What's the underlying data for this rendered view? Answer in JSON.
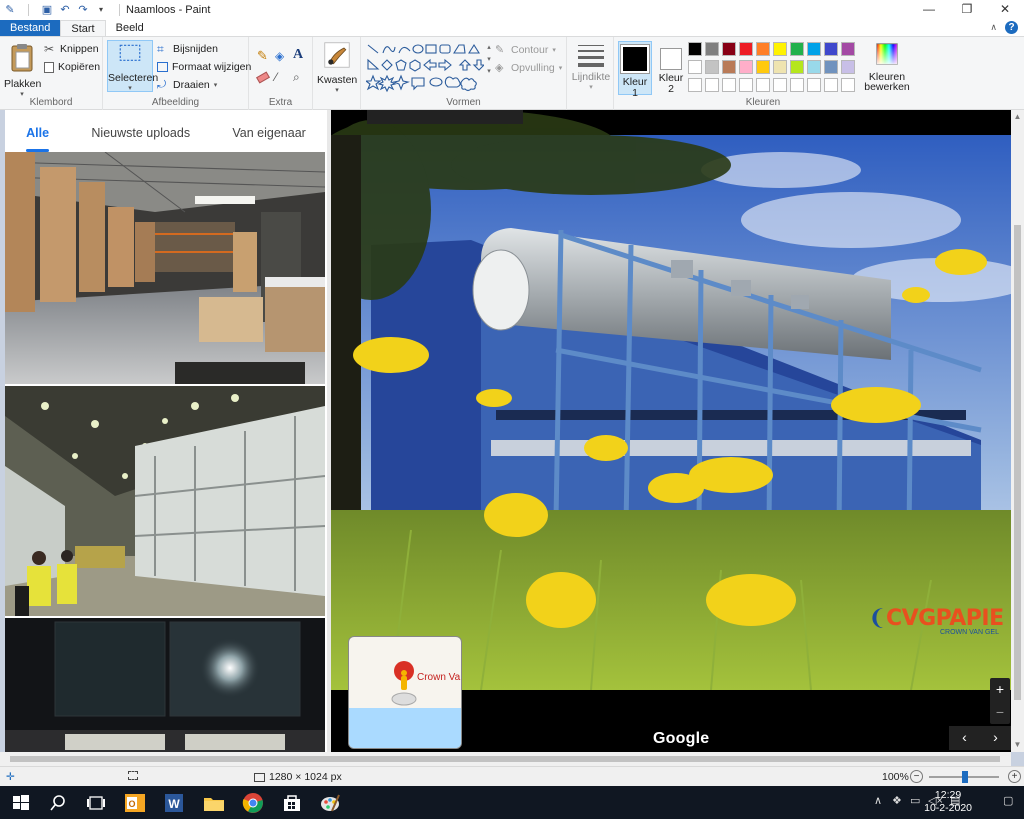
{
  "titlebar": {
    "title": "Naamloos - Paint",
    "controls": {
      "minimize": "—",
      "maximize": "❐",
      "close": "✕"
    }
  },
  "tabs": {
    "file": "Bestand",
    "home": "Start",
    "view": "Beeld"
  },
  "ribbon": {
    "clipboard": {
      "paste": "Plakken",
      "cut": "Knippen",
      "copy": "Kopiëren",
      "group": "Klembord"
    },
    "image": {
      "select": "Selecteren",
      "crop": "Bijsnijden",
      "resize": "Formaat wijzigen",
      "rotate": "Draaien",
      "group": "Afbeelding"
    },
    "tools": {
      "group": "Extra"
    },
    "brushes": {
      "label": "Kwasten"
    },
    "shapes": {
      "outline": "Contour",
      "fill": "Opvulling",
      "group": "Vormen"
    },
    "size": {
      "label": "Lijndikte"
    },
    "colors": {
      "color1": "Kleur",
      "color1_num": "1",
      "color2": "Kleur",
      "color2_num": "2",
      "edit": "Kleuren",
      "edit2": "bewerken",
      "group": "Kleuren",
      "palette_row1": [
        "#000000",
        "#7f7f7f",
        "#880015",
        "#ed1c24",
        "#ff7f27",
        "#fff200",
        "#22b14c",
        "#00a2e8",
        "#3f48cc",
        "#a349a4"
      ],
      "palette_row2": [
        "#ffffff",
        "#c3c3c3",
        "#b97a57",
        "#ffaec9",
        "#ffc90e",
        "#efe4b0",
        "#b5e61d",
        "#99d9ea",
        "#7092be",
        "#c8bfe7"
      ],
      "palette_row3": [
        "#ffffff",
        "#ffffff",
        "#ffffff",
        "#ffffff",
        "#ffffff",
        "#ffffff",
        "#ffffff",
        "#ffffff",
        "#ffffff",
        "#ffffff"
      ]
    }
  },
  "photos_panel": {
    "tabs": [
      "Alle",
      "Nieuwste uploads",
      "Van eigenaar"
    ]
  },
  "streetview": {
    "google": "Google",
    "minimap_label": "Crown Va",
    "zoom_in": "+",
    "zoom_out": "−",
    "prev": "‹",
    "next": "›",
    "brand_main_a": "CVG",
    "brand_main_b": "PAPIE",
    "brand_sub": "CROWN VAN GEL"
  },
  "statusbar": {
    "dimensions": "1280 × 1024 px",
    "zoom": "100%"
  },
  "taskbar": {
    "time": "12:29",
    "date": "10-2-2020"
  }
}
